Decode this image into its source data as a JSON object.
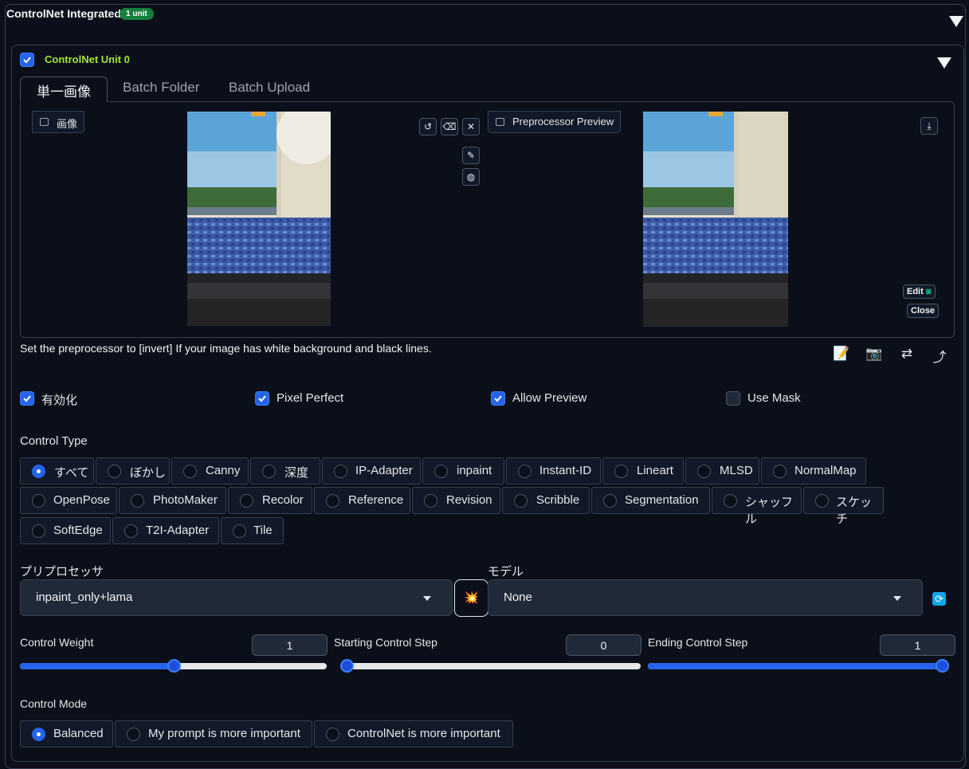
{
  "header": {
    "title": "ControlNet Integrated",
    "badge": "1 unit"
  },
  "unit": {
    "title": "ControlNet Unit 0",
    "enabled": true
  },
  "tabs": [
    "単一画像",
    "Batch Folder",
    "Batch Upload"
  ],
  "image_panel": {
    "input_label": "画像",
    "preview_label": "Preprocessor Preview",
    "edit_label": "Edit",
    "close_label": "Close"
  },
  "hint": "Set the preprocessor to [invert] If your image has white background and black lines.",
  "toolbar_icons": [
    "notepad-icon",
    "camera-icon",
    "swap-icon",
    "curved-arrow-icon"
  ],
  "checkboxes": [
    {
      "label": "有効化",
      "checked": true
    },
    {
      "label": "Pixel Perfect",
      "checked": true
    },
    {
      "label": "Allow Preview",
      "checked": true
    },
    {
      "label": "Use Mask",
      "checked": false
    }
  ],
  "control_type": {
    "label": "Control Type",
    "selected": "すべて",
    "options": [
      "すべて",
      "ぼかし",
      "Canny",
      "深度",
      "IP-Adapter",
      "inpaint",
      "Instant-ID",
      "Lineart",
      "MLSD",
      "NormalMap",
      "OpenPose",
      "PhotoMaker",
      "Recolor",
      "Reference",
      "Revision",
      "Scribble",
      "Segmentation",
      "シャッフル",
      "スケッチ",
      "SoftEdge",
      "T2I-Adapter",
      "Tile"
    ]
  },
  "preprocessor": {
    "label": "プリプロセッサ",
    "value": "inpaint_only+lama"
  },
  "model": {
    "label": "モデル",
    "value": "None"
  },
  "sliders": [
    {
      "label": "Control Weight",
      "value": "1",
      "fraction": 0.5
    },
    {
      "label": "Starting Control Step",
      "value": "0",
      "fraction": 0.0
    },
    {
      "label": "Ending Control Step",
      "value": "1",
      "fraction": 1.0
    }
  ],
  "control_mode": {
    "label": "Control Mode",
    "selected": "Balanced",
    "options": [
      "Balanced",
      "My prompt is more important",
      "ControlNet is more important"
    ]
  },
  "colors": {
    "accent": "#2563eb",
    "unit_title": "#a3e635",
    "badge": "#15803d",
    "background": "#0b0f19"
  }
}
